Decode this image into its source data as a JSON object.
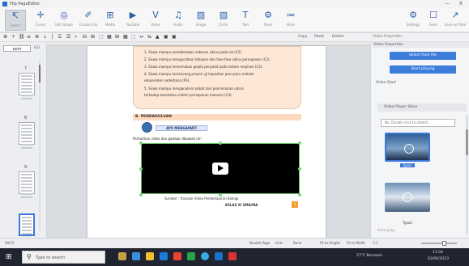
{
  "window": {
    "title": "Flip PageEditor",
    "minimize": "—",
    "close": "X"
  },
  "ribbon": {
    "buttons": [
      {
        "label": "Select",
        "icon": "↸"
      },
      {
        "label": "Cursor",
        "icon": "✛"
      },
      {
        "label": "Edit Shape",
        "icon": "◎"
      },
      {
        "label": "Create Link",
        "icon": "✐"
      },
      {
        "label": "Media",
        "icon": "⊞"
      },
      {
        "label": "YouTube",
        "icon": "▶"
      },
      {
        "label": "Video",
        "icon": "V"
      },
      {
        "label": "Audio",
        "icon": "♫"
      },
      {
        "label": "Image",
        "icon": "▨"
      },
      {
        "label": "Circle",
        "icon": "▧"
      },
      {
        "label": "Text",
        "icon": "T"
      },
      {
        "label": "Flash",
        "icon": "⚙"
      },
      {
        "label": "More",
        "icon": "≔"
      },
      {
        "label": "Settings",
        "icon": "⚙"
      },
      {
        "label": "Save",
        "icon": "☐"
      },
      {
        "label": "Save as Html",
        "icon": "↗"
      }
    ]
  },
  "toolbar": {
    "left_icons": [
      "≣",
      "+",
      "⛓",
      "≡",
      "≣",
      "⇣",
      "│",
      "⌸",
      "☰",
      "▿",
      "⊟",
      "⊞",
      "⬚",
      "▦",
      "⊞",
      "▦",
      "⬚",
      "↔",
      "⇆",
      "▲",
      "▣",
      "▣"
    ],
    "copy": "Copy",
    "paste": "Paste",
    "delete": "Delete",
    "props_label": "Video Properties"
  },
  "leftpanel": {
    "page_value": "10/27",
    "go": "GO",
    "thumbs": [
      "7",
      "8",
      "9"
    ]
  },
  "page": {
    "objectives": [
      "1.  Siswa mampu membedakan sebaran siklus pada sel (C2).",
      "2.  Siswa mampu mengurutkan tahapan dan fase-fase siklus pernapasan (C2).",
      "3.  Siswa mampu menemukan gejala penyakit pada sistem respirasi (C3).",
      "4.  Siswa mampu merancang proyek uji kapasitas paru-paru melalui",
      "     eksperimen sederhana (P3).",
      "5.  Siswa mampu menganalisis akibat dari pencemaran udara",
      "     terhadap kesehatan sistem pernapasan manusia (C4)."
    ],
    "section": "B. PENDAHULUAN",
    "activity": "AYO MENGAMATI",
    "instruction": "Perhatikan video dan gambar dibawah ini!",
    "caption": "Sumber : Youtube Video Pembelajaran Biologi",
    "footer_text": "KELAS XI SMA/MA",
    "page_badge": "1"
  },
  "rightpanel": {
    "header": "Video Properties",
    "select_btn": "Select from file",
    "start_btn": "Start playing",
    "video_label": "Video Start",
    "section": "Video Player Skins",
    "add_label": "No. Disable click to stretch",
    "skins": [
      "Type1",
      "Type2"
    ],
    "auto_label": "Auto play"
  },
  "statusbar": {
    "items": [
      "Double Page",
      "Grid",
      "Bone",
      "Fit to Height",
      "Fit to Width",
      "1:1"
    ],
    "page_indicator": "00/15"
  },
  "taskbar": {
    "search_placeholder": "Type to search",
    "tray_weather": "27°C Berawan",
    "tray_time": "11:04",
    "tray_date": "03/06/2023"
  },
  "colors": {
    "accent": "#3c7ddb",
    "peach": "#fde7d6",
    "video_border": "#5fbf5f"
  }
}
